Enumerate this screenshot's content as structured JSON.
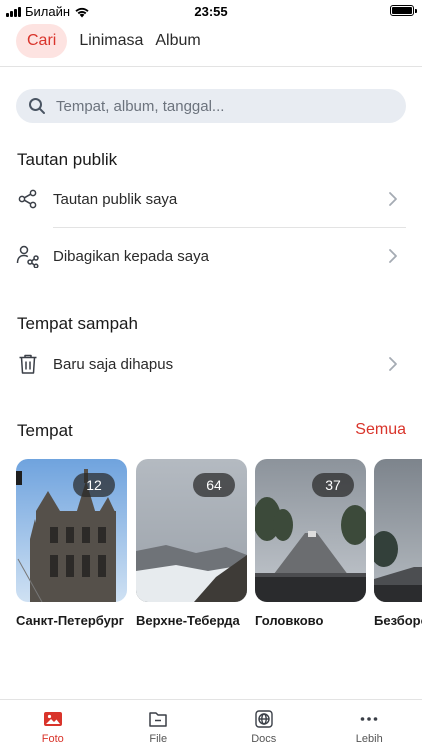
{
  "status_bar": {
    "carrier": "Билайн",
    "time": "23:55"
  },
  "tabs": [
    {
      "label": "Cari",
      "active": true
    },
    {
      "label": "Linimasa",
      "active": false
    },
    {
      "label": "Album",
      "active": false
    }
  ],
  "search": {
    "placeholder": "Tempat, album, tanggal..."
  },
  "public_links": {
    "title": "Tautan publik",
    "items": [
      {
        "label": "Tautan publik saya",
        "icon": "share-icon"
      },
      {
        "label": "Dibagikan kepada saya",
        "icon": "shared-with-me-icon"
      }
    ]
  },
  "trash": {
    "title": "Tempat sampah",
    "items": [
      {
        "label": "Baru saja dihapus",
        "icon": "trash-icon"
      }
    ]
  },
  "places": {
    "title": "Tempat",
    "see_all": "Semua",
    "items": [
      {
        "name": "Санкт-Петербург",
        "count": "12"
      },
      {
        "name": "Верхне-Теберда",
        "count": "64"
      },
      {
        "name": "Головково",
        "count": "37"
      },
      {
        "name": "Безборово",
        "count": ""
      }
    ]
  },
  "bottom_nav": [
    {
      "label": "Foto",
      "icon": "photo-icon",
      "active": true
    },
    {
      "label": "File",
      "icon": "folder-icon",
      "active": false
    },
    {
      "label": "Docs",
      "icon": "docs-icon",
      "active": false
    },
    {
      "label": "Lebih",
      "icon": "more-icon",
      "active": false
    }
  ],
  "colors": {
    "accent": "#d9342b",
    "active_tab_bg": "#fde3e1",
    "search_bg": "#e8ecf2"
  }
}
